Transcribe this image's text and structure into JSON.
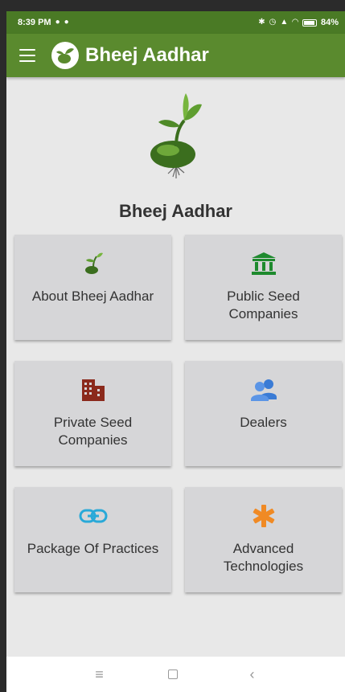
{
  "status_bar": {
    "time": "8:39 PM",
    "battery": "84%"
  },
  "app_bar": {
    "title": "Bheej Aadhar"
  },
  "main": {
    "title": "Bheej Aadhar",
    "cards": [
      {
        "label": "About Bheej Aadhar",
        "icon": "sprout-icon",
        "color": "#4a7a25"
      },
      {
        "label": "Public Seed\nCompanies",
        "icon": "bank-icon",
        "color": "#1e8a2e"
      },
      {
        "label": "Private Seed\nCompanies",
        "icon": "building-icon",
        "color": "#8b2a1c"
      },
      {
        "label": "Dealers",
        "icon": "people-icon",
        "color": "#3a7bd5"
      },
      {
        "label": "Package Of Practices",
        "icon": "link-icon",
        "color": "#29a9d8"
      },
      {
        "label": "Advanced\nTechnologies",
        "icon": "asterisk-icon",
        "color": "#f08a24"
      }
    ]
  },
  "colors": {
    "status_bar": "#4a7a25",
    "app_bar": "#5a8a2e",
    "background": "#e8e8e8",
    "card": "#d6d6d8"
  }
}
